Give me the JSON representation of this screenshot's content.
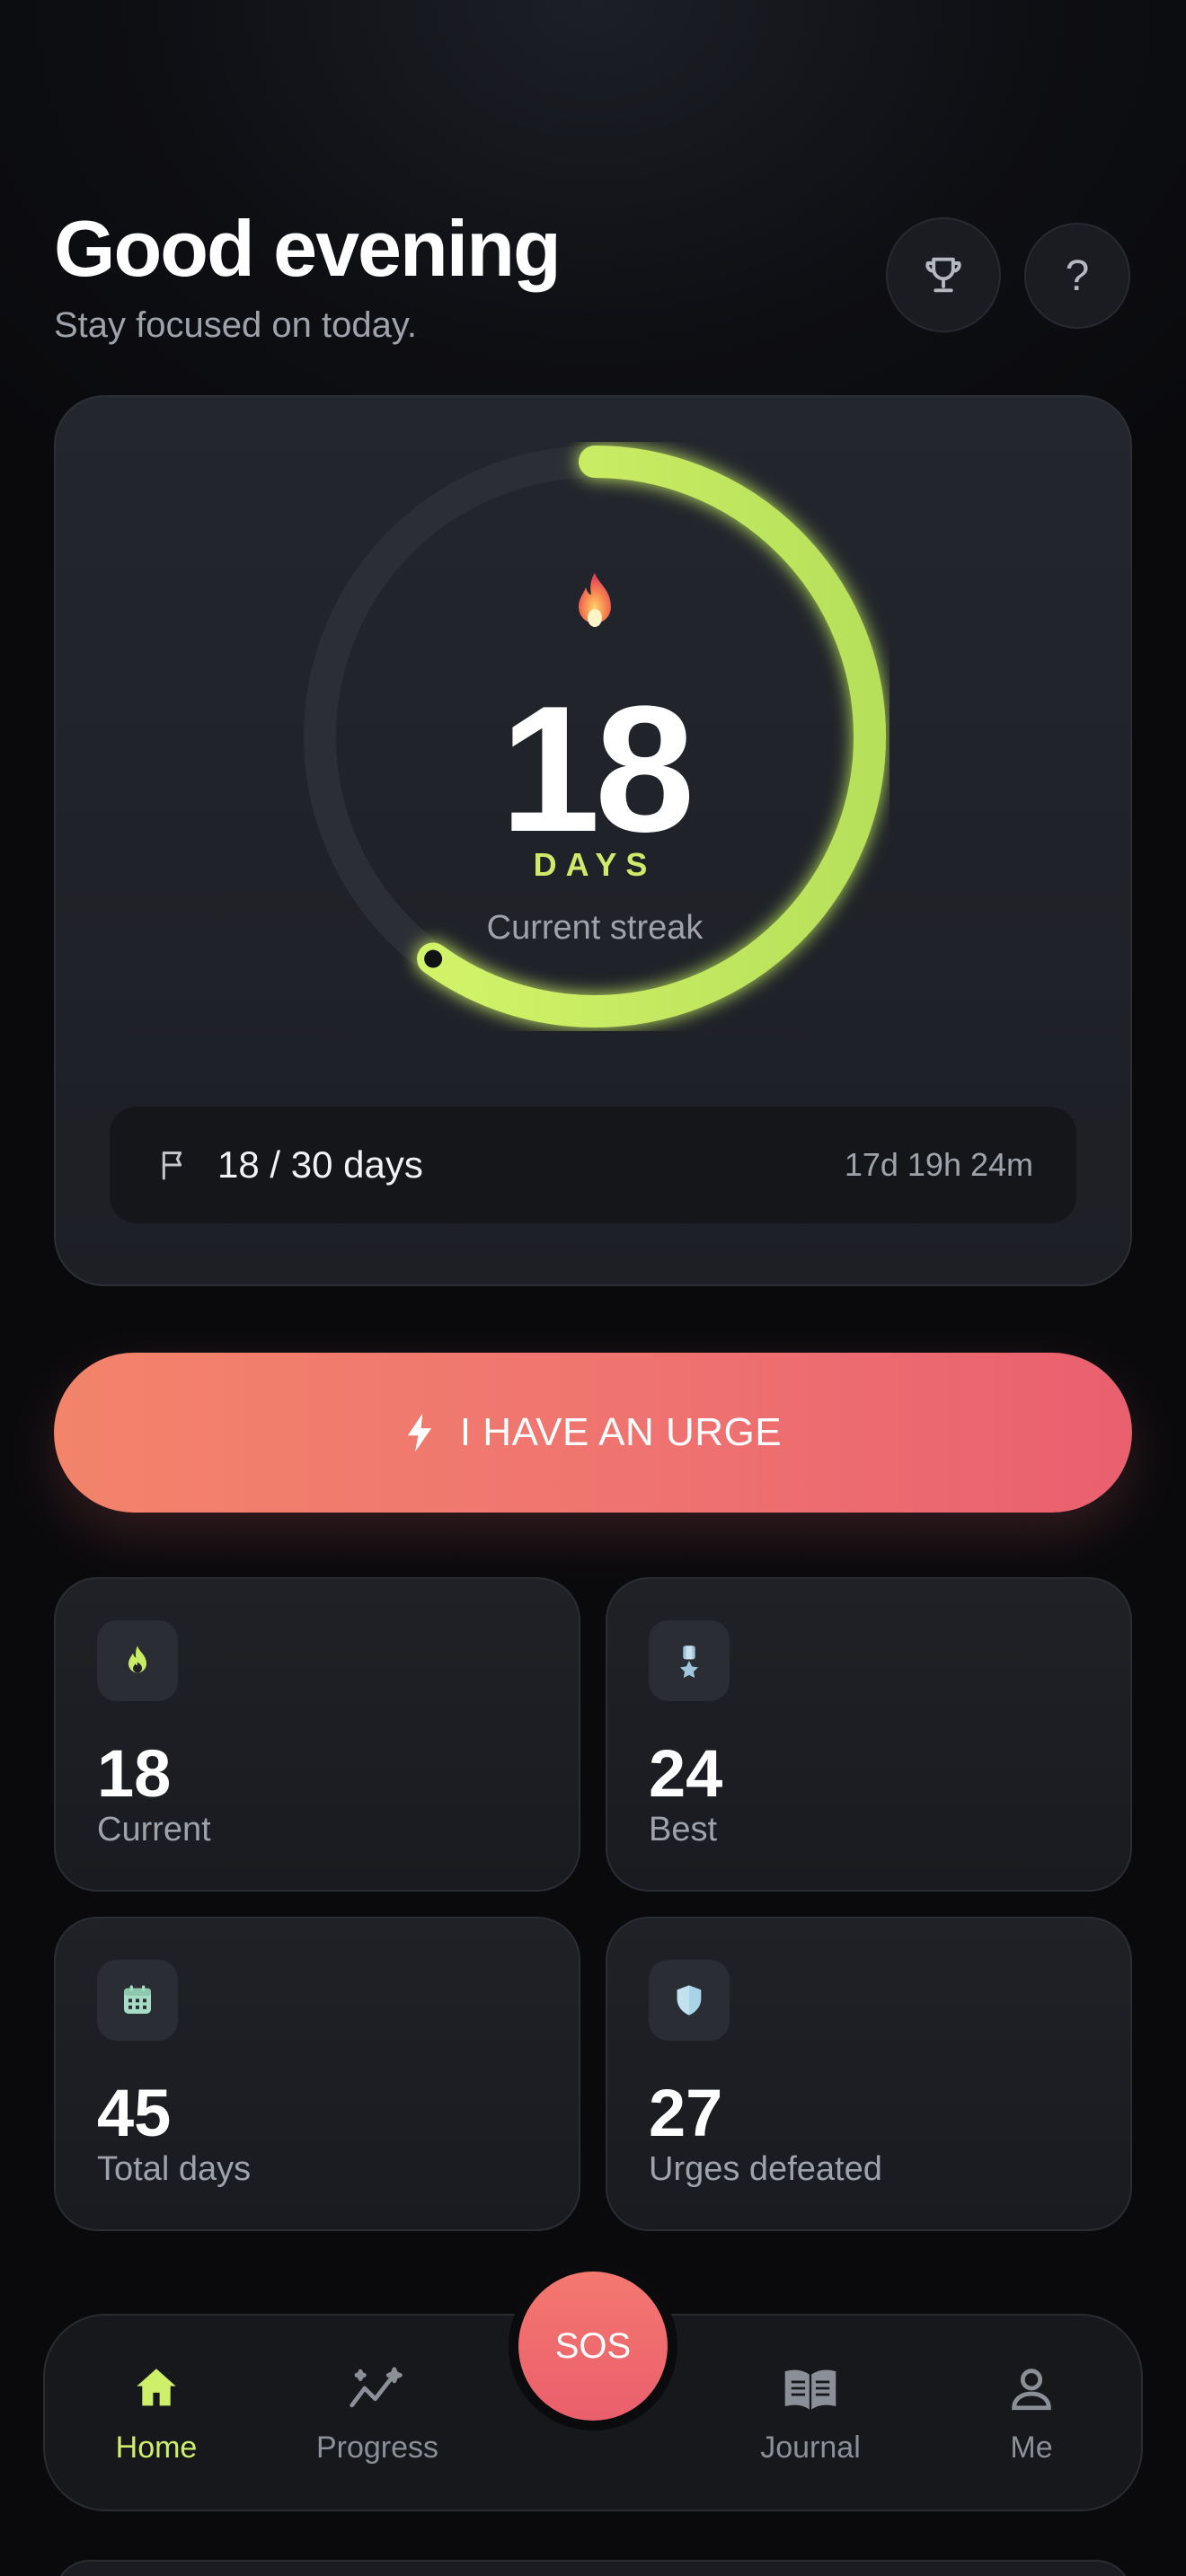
{
  "header": {
    "greeting": "Good evening",
    "subtitle": "Stay focused on today."
  },
  "header_buttons": {
    "trophy_icon": "trophy-icon",
    "help_label": "?"
  },
  "streak": {
    "count": "18",
    "unit": "DAYS",
    "caption": "Current streak",
    "progress_fraction": 0.6,
    "goal_text": "18 / 30 days",
    "time_left": "17d 19h 24m"
  },
  "urge_button": {
    "label": "I HAVE AN URGE"
  },
  "stats": [
    {
      "value": "18",
      "label": "Current",
      "icon": "flame-icon"
    },
    {
      "value": "24",
      "label": "Best",
      "icon": "medal-icon"
    },
    {
      "value": "45",
      "label": "Total days",
      "icon": "calendar-icon"
    },
    {
      "value": "27",
      "label": "Urges defeated",
      "icon": "shield-icon"
    }
  ],
  "nav": {
    "items": [
      {
        "label": "Home",
        "icon": "home-icon",
        "active": true
      },
      {
        "label": "Progress",
        "icon": "progress-icon",
        "active": false
      },
      {
        "label": "Journal",
        "icon": "journal-icon",
        "active": false
      },
      {
        "label": "Me",
        "icon": "person-icon",
        "active": false
      }
    ],
    "sos_label": "SOS"
  },
  "colors": {
    "accent": "#cdef6a",
    "urge": "#ef7370",
    "background": "#0b0c0f"
  }
}
